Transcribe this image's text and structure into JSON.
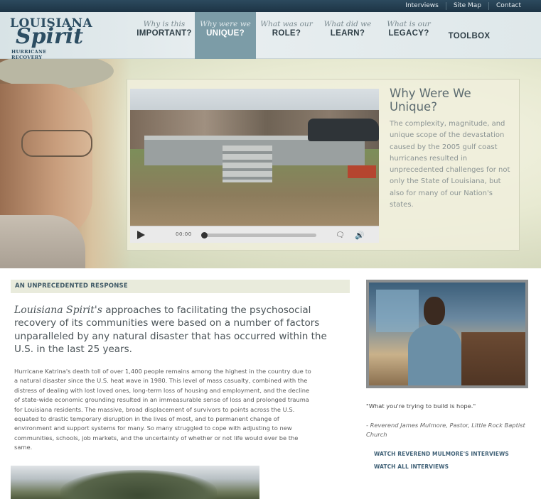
{
  "topbar": {
    "links": [
      "Interviews",
      "Site Map",
      "Contact"
    ]
  },
  "logo": {
    "line1": "LOUISIANA",
    "line2": "Spirit",
    "line3": "HURRICANE RECOVERY"
  },
  "nav": {
    "items": [
      {
        "question": "Why is this",
        "keyword": "IMPORTANT?",
        "active": false
      },
      {
        "question": "Why were we",
        "keyword": "UNIQUE?",
        "active": true
      },
      {
        "question": "What was our",
        "keyword": "ROLE?",
        "active": false
      },
      {
        "question": "What did we",
        "keyword": "LEARN?",
        "active": false
      },
      {
        "question": "What is our",
        "keyword": "LEGACY?",
        "active": false
      }
    ],
    "toolbox": "TOOLBOX"
  },
  "hero": {
    "title": "Why Were We Unique?",
    "description": "The complexity, magnitude, and unique scope of the devastation caused by the 2005 gulf coast hurricanes resulted in unprecedented challenges for not only the State of Louisiana, but also for many of our Nation's states.",
    "player": {
      "time": "00:00",
      "progress": 0
    }
  },
  "content": {
    "section_title": "AN UNPRECEDENTED RESPONSE",
    "lede_emph": "Louisiana Spirit's",
    "lede_rest": " approaches to facilitating the psychosocial recovery of its communities were based on a number of factors unparalleled by any natural disaster that has occurred within the U.S. in the last 25 years.",
    "body": "Hurricane Katrina's death toll of over 1,400 people remains among the highest in the country due to a natural disaster since the U.S. heat wave in 1980. This level of mass casualty, combined with the distress of dealing with lost loved ones, long-term loss of housing and employment, and the decline of state-wide economic grounding resulted in an immeasurable sense of loss and prolonged trauma for Louisiana residents. The massive, broad displacement of survivors to points across the U.S. equated to drastic temporary disruption in the lives of most, and to permanent change of environment and support systems for many. So many struggled to cope with adjusting to new communities, schools, job markets, and the uncertainty of whether or not life would ever be the same."
  },
  "sidebar": {
    "quote": "\"What you're trying to build is hope.\"",
    "attribution": "- Reverend James Mulmore, Pastor, Little Rock Baptist Church",
    "link1": "WATCH REVEREND MULMORE'S INTERVIEWS",
    "link2": "WATCH ALL INTERVIEWS"
  },
  "colors": {
    "topbar": "#1d3445",
    "nav_active": "#7c9ca7",
    "link": "#3f6076"
  }
}
